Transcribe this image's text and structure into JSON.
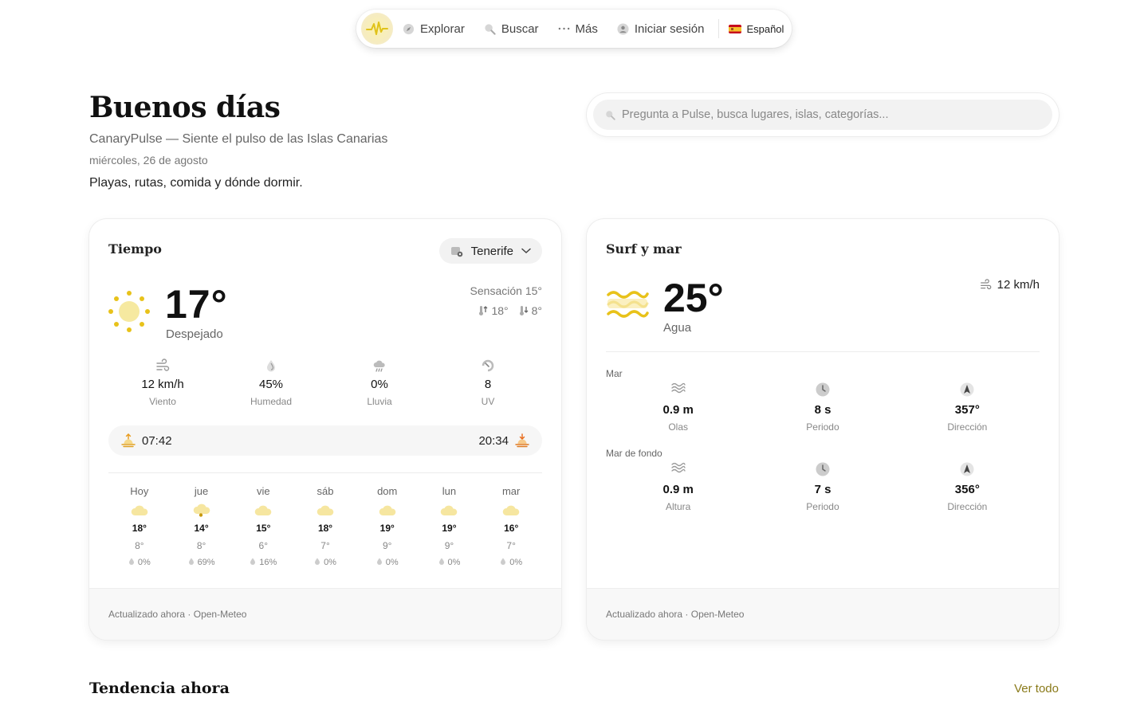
{
  "nav": {
    "items": [
      {
        "label": "Explorar",
        "icon": "compass-icon"
      },
      {
        "label": "Buscar",
        "icon": "search-icon"
      },
      {
        "label": "Más",
        "icon": "dots-icon"
      },
      {
        "label": "Iniciar sesión",
        "icon": "user-icon"
      }
    ],
    "language": "Español"
  },
  "hero": {
    "greeting": "Buenos días",
    "tagline": "CanaryPulse — Siente el pulso de las Islas Canarias",
    "date": "miércoles, 26 de agosto",
    "subtitle": "Playas, rutas, comida y dónde dormir."
  },
  "search": {
    "placeholder": "Pregunta a Pulse, busca lugares, islas, categorías..."
  },
  "weather": {
    "title": "Tiempo",
    "island": "Tenerife",
    "temp": "17°",
    "condition": "Despejado",
    "feels_like": "Sensación 15°",
    "max": "18°",
    "min": "8°",
    "stats": [
      {
        "value": "12 km/h",
        "label": "Viento",
        "icon": "wind-icon"
      },
      {
        "value": "45%",
        "label": "Humedad",
        "icon": "droplet-icon"
      },
      {
        "value": "0%",
        "label": "Lluvia",
        "icon": "rain-cloud-icon"
      },
      {
        "value": "8",
        "label": "UV",
        "icon": "uv-icon"
      }
    ],
    "sunrise": "07:42",
    "sunset": "20:34",
    "forecast": [
      {
        "day": "Hoy",
        "hi": "18°",
        "lo": "8°",
        "rain": "0%",
        "icon": "cloud-icon"
      },
      {
        "day": "jue",
        "hi": "14°",
        "lo": "8°",
        "rain": "69%",
        "icon": "rain-cloud-icon"
      },
      {
        "day": "vie",
        "hi": "15°",
        "lo": "6°",
        "rain": "16%",
        "icon": "cloud-icon"
      },
      {
        "day": "sáb",
        "hi": "18°",
        "lo": "7°",
        "rain": "0%",
        "icon": "cloud-icon"
      },
      {
        "day": "dom",
        "hi": "19°",
        "lo": "9°",
        "rain": "0%",
        "icon": "cloud-icon"
      },
      {
        "day": "lun",
        "hi": "19°",
        "lo": "9°",
        "rain": "0%",
        "icon": "cloud-icon"
      },
      {
        "day": "mar",
        "hi": "16°",
        "lo": "7°",
        "rain": "0%",
        "icon": "cloud-icon"
      }
    ],
    "footer": "Actualizado ahora · Open-Meteo"
  },
  "surf": {
    "title": "Surf y mar",
    "water_temp": "25°",
    "water_label": "Agua",
    "wind": "12 km/h",
    "sea_label": "Mar",
    "sea": [
      {
        "value": "0.9 m",
        "label": "Olas",
        "icon": "waves-icon"
      },
      {
        "value": "8 s",
        "label": "Periodo",
        "icon": "clock-icon"
      },
      {
        "value": "357°",
        "label": "Dirección",
        "icon": "direction-arrow-icon"
      }
    ],
    "swell_label": "Mar de fondo",
    "swell": [
      {
        "value": "0.9 m",
        "label": "Altura",
        "icon": "waves-icon"
      },
      {
        "value": "7 s",
        "label": "Periodo",
        "icon": "clock-icon"
      },
      {
        "value": "356°",
        "label": "Dirección",
        "icon": "direction-arrow-icon"
      }
    ],
    "footer": "Actualizado ahora · Open-Meteo"
  },
  "trending": {
    "title": "Tendencia ahora",
    "see_all": "Ver todo"
  },
  "colors": {
    "accent": "#e8c21a",
    "link": "#8a7a1a"
  }
}
